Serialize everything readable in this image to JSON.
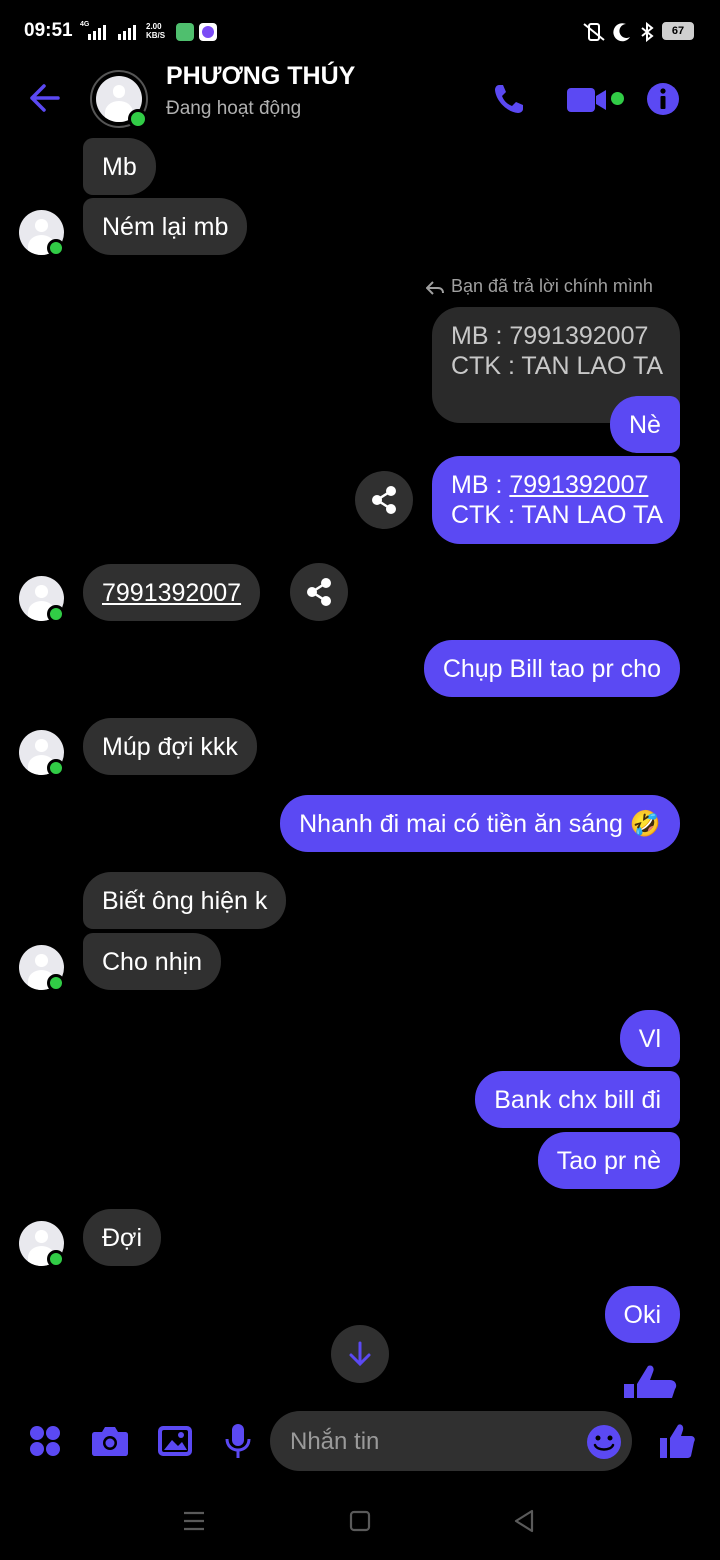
{
  "status_bar": {
    "time": "09:51",
    "network": "4G",
    "speed_value": "2.00",
    "speed_unit": "KB/S",
    "battery": "67"
  },
  "header": {
    "name": "PHƯƠNG THÚY",
    "status": "Đang hoạt động"
  },
  "messages": {
    "m1": "Mb",
    "m2": "Ném lại mb",
    "reply_note": "Bạn đã trả lời chính mình",
    "quote_line1": "MB : 7991392007",
    "quote_line2": "CTK : TAN LAO TA",
    "m3": "Nè",
    "m4_prefix": "MB : ",
    "m4_number": "7991392007",
    "m4_line2": "CTK : TAN LAO TA",
    "m5": "7991392007",
    "m6": "Chụp Bill tao pr cho",
    "m7": "Múp đợi kkk",
    "m8": "Nhanh đi mai có tiền ăn sáng 🤣",
    "m9": "Biết ông hiện k",
    "m10": "Cho nhịn",
    "m11": "Vl",
    "m12": "Bank chx bill đi",
    "m13": "Tao pr nè",
    "m14": "Đợi",
    "m15": "Oki"
  },
  "composer": {
    "placeholder": "Nhắn tin"
  },
  "colors": {
    "accent": "#5b49f3",
    "incoming_bubble": "#303030",
    "online": "#31cc46",
    "background": "#000000"
  },
  "icons": [
    "back-arrow-icon",
    "phone-icon",
    "video-icon",
    "info-icon",
    "share-icon",
    "scroll-down-icon",
    "apps-icon",
    "camera-icon",
    "gallery-icon",
    "mic-icon",
    "emoji-icon",
    "thumbs-up-icon"
  ]
}
